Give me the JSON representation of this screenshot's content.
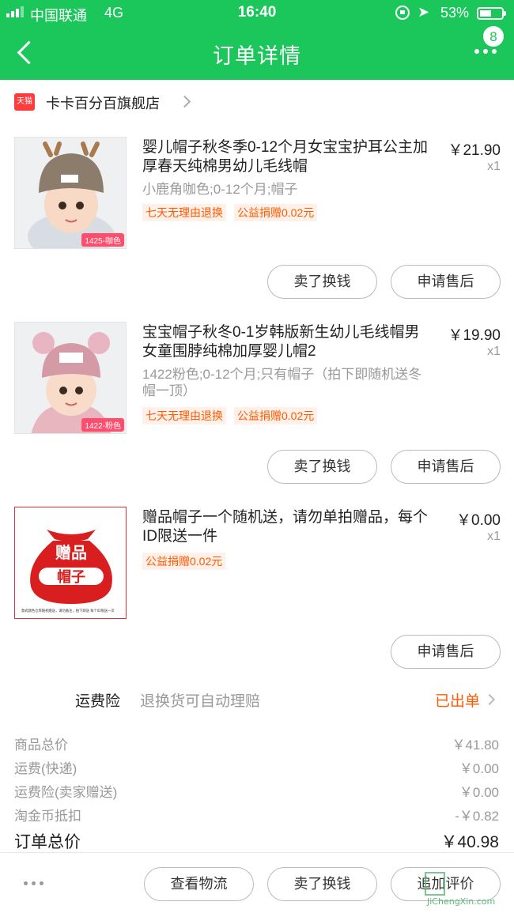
{
  "status_bar": {
    "carrier": "中国联通",
    "network": "4G",
    "time": "16:40",
    "battery": "53%",
    "battery_level": 0.53
  },
  "header": {
    "title": "订单详情",
    "badge": "8"
  },
  "shop": {
    "badge": "天猫",
    "name": "卡卡百分百旗舰店"
  },
  "items": [
    {
      "name": "婴儿帽子秋冬季0-12个月女宝宝护耳公主加厚春天纯棉男幼儿毛线帽",
      "price": "￥21.90",
      "qty": "x1",
      "spec": "小鹿角咖色;0-12个月;帽子",
      "tags": [
        "七天无理由退换",
        "公益捐赠0.02元"
      ],
      "thumb_label": "1425-咖色",
      "buttons": [
        "卖了换钱",
        "申请售后"
      ]
    },
    {
      "name": "宝宝帽子秋冬0-1岁韩版新生幼儿毛线帽男女童围脖纯棉加厚婴儿帽2",
      "price": "￥19.90",
      "qty": "x1",
      "spec": "1422粉色;0-12个月;只有帽子（拍下即随机送冬帽一顶）",
      "tags": [
        "七天无理由退换",
        "公益捐赠0.02元"
      ],
      "thumb_label": "1422-粉色",
      "buttons": [
        "卖了换钱",
        "申请售后"
      ]
    },
    {
      "name": "赠品帽子一个随机送，请勿单拍赠品，每个ID限送一件",
      "price": "￥0.00",
      "qty": "x1",
      "tags": [
        "公益捐赠0.02元"
      ],
      "gift_line1": "赠品",
      "gift_line2": "帽子",
      "gift_note": "款式颜色仓库随机赠送，请勿备注，拍下即送 每个ID限送一次",
      "buttons": [
        "申请售后"
      ]
    }
  ],
  "insurance": {
    "label": "运费险",
    "desc": "退换货可自动理赔",
    "status": "已出单"
  },
  "summary": {
    "rows": [
      {
        "k": "商品总价",
        "v": "￥41.80"
      },
      {
        "k": "运费(快递)",
        "v": "￥0.00"
      },
      {
        "k": "运费险(卖家赠送)",
        "v": "￥0.00"
      },
      {
        "k": "淘金币抵扣",
        "v": "-￥0.82"
      }
    ],
    "total_label": "订单总价",
    "total_value": "￥40.98"
  },
  "bottom_bar": {
    "buttons": [
      "查看物流",
      "卖了换钱",
      "追加评价"
    ]
  },
  "watermark": "JiChengXin.com",
  "colors": {
    "header": "#1bc75a",
    "accent": "#ff5a00"
  }
}
